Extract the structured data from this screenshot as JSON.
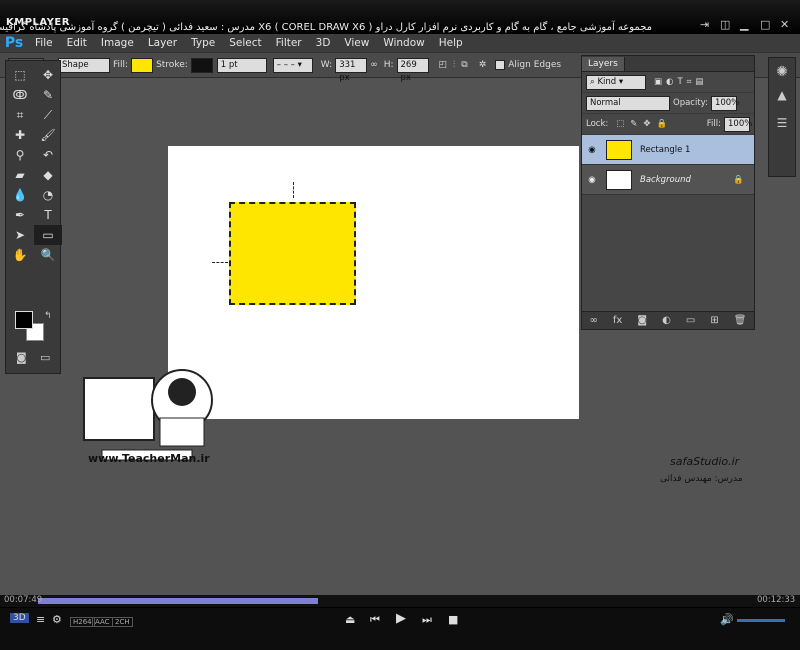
{
  "player": {
    "brand": "KMPLAYER",
    "title": "مجموعه آموزشی جامع ، گام به گام و کاربردی نرم افزار کارل دراو  X6  ( COREL DRAW X6 )   مدرس : سعید فدائی ( تیچرمن ) گروه آموزشی پادشاه گرافیست ها",
    "time_elapsed": "00:07:49",
    "time_total": "00:12:33",
    "progress": 0.35,
    "badges": [
      "H264",
      "AAC",
      "2CH"
    ]
  },
  "menu": [
    "File",
    "Edit",
    "Image",
    "Layer",
    "Type",
    "Select",
    "Filter",
    "3D",
    "View",
    "Window",
    "Help"
  ],
  "options": {
    "shape_mode": "Shape",
    "fill_label": "Fill:",
    "fill_color": "#ffe600",
    "stroke_label": "Stroke:",
    "stroke_color": "#111111",
    "stroke_width": "1 pt",
    "w_label": "W:",
    "w_value": "331 px",
    "h_label": "H:",
    "h_value": "269 px",
    "align_edges": "Align Edges"
  },
  "layers_panel": {
    "tab": "Layers",
    "kind": "Kind",
    "blend": "Normal",
    "opacity_label": "Opacity:",
    "opacity": "100%",
    "lock_label": "Lock:",
    "fill_label": "Fill:",
    "fill": "100%",
    "layers": [
      {
        "name": "Rectangle 1",
        "selected": true
      },
      {
        "name": "Background",
        "selected": false
      }
    ]
  },
  "watermark": {
    "site": "www.TeacherMan.ir",
    "studio": "safaStudio.ir",
    "teacher": "مدرس: مهندس فدائی"
  },
  "icons": [
    "ps-logo",
    "move-tool",
    "marquee-tool",
    "lasso-tool",
    "crop-tool",
    "brush-tool",
    "text-tool",
    "rectangle-tool",
    "hand-tool",
    "zoom-tool",
    "eye-icon",
    "lock-icon",
    "play-icon",
    "pause-icon",
    "stop-icon",
    "volume-icon"
  ]
}
